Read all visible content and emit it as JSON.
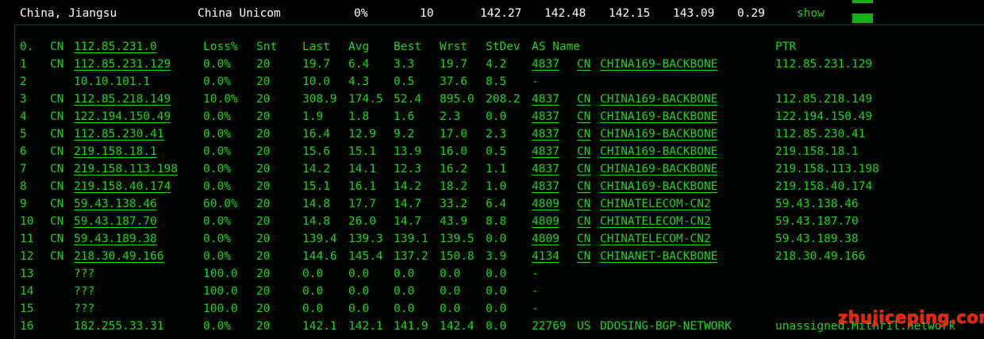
{
  "summary": {
    "location": "China, Jiangsu",
    "isp": "China Unicom",
    "loss": "0%",
    "sent": "10",
    "last": "142.27",
    "avg": "142.48",
    "best": "142.15",
    "worst": "143.09",
    "stdev": "0.29",
    "action": "show"
  },
  "header": {
    "hop": "0.",
    "cc": "CN",
    "host": "112.85.231.0",
    "loss": "Loss%",
    "snt": "Snt",
    "last": "Last",
    "avg": "Avg",
    "best": "Best",
    "wrst": "Wrst",
    "stdev": "StDev",
    "asname": "AS Name",
    "ptr": "PTR"
  },
  "hops": [
    {
      "hop": "1",
      "cc": "CN",
      "host": "112.85.231.129",
      "loss": "0.0%",
      "snt": "20",
      "last": "19.7",
      "avg": "6.4",
      "best": "3.3",
      "wrst": "19.7",
      "stdev": "4.2",
      "asn": "4837",
      "ascc": "CN",
      "asname": "CHINA169-BACKBONE",
      "ptr": "112.85.231.129"
    },
    {
      "hop": "2",
      "cc": "",
      "host": "10.10.101.1",
      "loss": "0.0%",
      "snt": "20",
      "last": "10.0",
      "avg": "4.3",
      "best": "0.5",
      "wrst": "37.6",
      "stdev": "8.5",
      "asn": "-",
      "ascc": "",
      "asname": "",
      "ptr": ""
    },
    {
      "hop": "3",
      "cc": "CN",
      "host": "112.85.218.149",
      "loss": "10.0%",
      "snt": "20",
      "last": "308.9",
      "avg": "174.5",
      "best": "52.4",
      "wrst": "895.0",
      "stdev": "208.2",
      "asn": "4837",
      "ascc": "CN",
      "asname": "CHINA169-BACKBONE",
      "ptr": "112.85.218.149"
    },
    {
      "hop": "4",
      "cc": "CN",
      "host": "122.194.150.49",
      "loss": "0.0%",
      "snt": "20",
      "last": "1.9",
      "avg": "1.8",
      "best": "1.6",
      "wrst": "2.3",
      "stdev": "0.0",
      "asn": "4837",
      "ascc": "CN",
      "asname": "CHINA169-BACKBONE",
      "ptr": "122.194.150.49"
    },
    {
      "hop": "5",
      "cc": "CN",
      "host": "112.85.230.41",
      "loss": "0.0%",
      "snt": "20",
      "last": "16.4",
      "avg": "12.9",
      "best": "9.2",
      "wrst": "17.0",
      "stdev": "2.3",
      "asn": "4837",
      "ascc": "CN",
      "asname": "CHINA169-BACKBONE",
      "ptr": "112.85.230.41"
    },
    {
      "hop": "6",
      "cc": "CN",
      "host": "219.158.18.1",
      "loss": "0.0%",
      "snt": "20",
      "last": "15.6",
      "avg": "15.1",
      "best": "13.9",
      "wrst": "16.0",
      "stdev": "0.5",
      "asn": "4837",
      "ascc": "CN",
      "asname": "CHINA169-BACKBONE",
      "ptr": "219.158.18.1"
    },
    {
      "hop": "7",
      "cc": "CN",
      "host": "219.158.113.198",
      "loss": "0.0%",
      "snt": "20",
      "last": "14.2",
      "avg": "14.1",
      "best": "12.3",
      "wrst": "16.2",
      "stdev": "1.1",
      "asn": "4837",
      "ascc": "CN",
      "asname": "CHINA169-BACKBONE",
      "ptr": "219.158.113.198"
    },
    {
      "hop": "8",
      "cc": "CN",
      "host": "219.158.40.174",
      "loss": "0.0%",
      "snt": "20",
      "last": "15.1",
      "avg": "16.1",
      "best": "14.2",
      "wrst": "18.2",
      "stdev": "1.0",
      "asn": "4837",
      "ascc": "CN",
      "asname": "CHINA169-BACKBONE",
      "ptr": "219.158.40.174"
    },
    {
      "hop": "9",
      "cc": "CN",
      "host": "59.43.138.46",
      "loss": "60.0%",
      "snt": "20",
      "last": "14.8",
      "avg": "17.7",
      "best": "14.7",
      "wrst": "33.2",
      "stdev": "6.4",
      "asn": "4809",
      "ascc": "CN",
      "asname": "CHINATELECOM-CN2",
      "ptr": "59.43.138.46"
    },
    {
      "hop": "10",
      "cc": "CN",
      "host": "59.43.187.70",
      "loss": "0.0%",
      "snt": "20",
      "last": "14.8",
      "avg": "26.0",
      "best": "14.7",
      "wrst": "43.9",
      "stdev": "8.8",
      "asn": "4809",
      "ascc": "CN",
      "asname": "CHINATELECOM-CN2",
      "ptr": "59.43.187.70"
    },
    {
      "hop": "11",
      "cc": "CN",
      "host": "59.43.189.38",
      "loss": "0.0%",
      "snt": "20",
      "last": "139.4",
      "avg": "139.3",
      "best": "139.1",
      "wrst": "139.5",
      "stdev": "0.0",
      "asn": "4809",
      "ascc": "CN",
      "asname": "CHINATELECOM-CN2",
      "ptr": "59.43.189.38"
    },
    {
      "hop": "12",
      "cc": "CN",
      "host": "218.30.49.166",
      "loss": "0.0%",
      "snt": "20",
      "last": "144.6",
      "avg": "145.4",
      "best": "137.2",
      "wrst": "150.8",
      "stdev": "3.9",
      "asn": "4134",
      "ascc": "CN",
      "asname": "CHINANET-BACKBONE",
      "ptr": "218.30.49.166"
    },
    {
      "hop": "13",
      "cc": "",
      "host": "???",
      "loss": "100.0",
      "snt": "20",
      "last": "0.0",
      "avg": "0.0",
      "best": "0.0",
      "wrst": "0.0",
      "stdev": "0.0",
      "asn": "-",
      "ascc": "",
      "asname": "",
      "ptr": ""
    },
    {
      "hop": "14",
      "cc": "",
      "host": "???",
      "loss": "100.0",
      "snt": "20",
      "last": "0.0",
      "avg": "0.0",
      "best": "0.0",
      "wrst": "0.0",
      "stdev": "0.0",
      "asn": "-",
      "ascc": "",
      "asname": "",
      "ptr": ""
    },
    {
      "hop": "15",
      "cc": "",
      "host": "???",
      "loss": "100.0",
      "snt": "20",
      "last": "0.0",
      "avg": "0.0",
      "best": "0.0",
      "wrst": "0.0",
      "stdev": "0.0",
      "asn": "-",
      "ascc": "",
      "asname": "",
      "ptr": ""
    },
    {
      "hop": "16",
      "cc": "",
      "host": "182.255.33.31",
      "loss": "0.0%",
      "snt": "20",
      "last": "142.1",
      "avg": "142.1",
      "best": "141.9",
      "wrst": "142.4",
      "stdev": "0.0",
      "asn": "22769",
      "ascc": "US",
      "asname": "DDOSING-BGP-NETWORK",
      "ptr": "unassigned.Mithril.network"
    }
  ],
  "watermark": "zhujiceping.com",
  "colors": {
    "background": "#000000",
    "text_green": "#1ed21e",
    "text_white": "#ffffff",
    "watermark_red": "#ff1a00"
  }
}
